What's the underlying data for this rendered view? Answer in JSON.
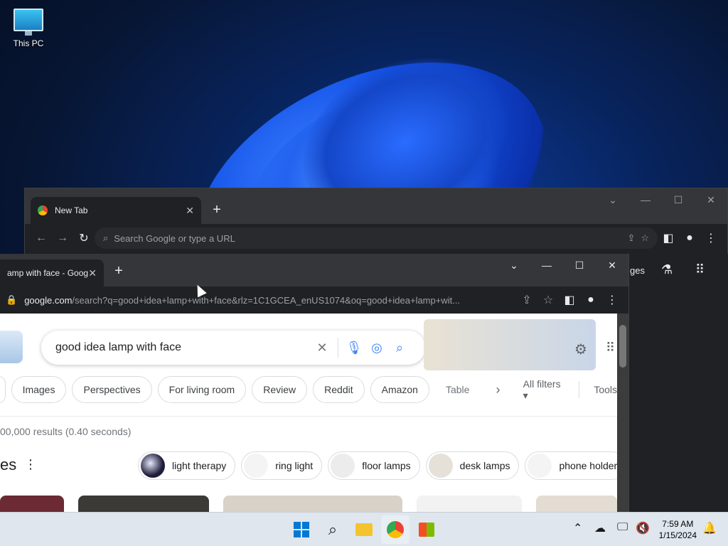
{
  "desktop": {
    "icon_label": "This PC"
  },
  "back_window": {
    "tab_title": "New Tab",
    "omnibox_placeholder": "Search Google or type a URL",
    "right_partial_text": "ges"
  },
  "front_window": {
    "tab_title": "amp with face - Goog",
    "url_domain": "google.com",
    "url_path": "/search?q=good+idea+lamp+with+face&rlz=1C1GCEA_enUS1074&oq=good+idea+lamp+wit..."
  },
  "search": {
    "query": "good idea lamp with face",
    "chips": [
      "Images",
      "Perspectives",
      "For living room",
      "Review",
      "Reddit",
      "Amazon",
      "Table"
    ],
    "all_filters": "All filters",
    "tools": "Tools",
    "results_stats": "00,000 results (0.40 seconds)",
    "images_heading": "es",
    "related": [
      "light therapy",
      "ring light",
      "floor lamps",
      "desk lamps",
      "phone holder"
    ]
  },
  "taskbar": {
    "time": "7:59 AM",
    "date": "1/15/2024"
  },
  "icons": {
    "this_pc": "monitor-icon",
    "start": "windows-start-icon",
    "search": "search-icon",
    "explorer": "folder-icon",
    "chrome": "chrome-icon",
    "store": "store-icon"
  }
}
